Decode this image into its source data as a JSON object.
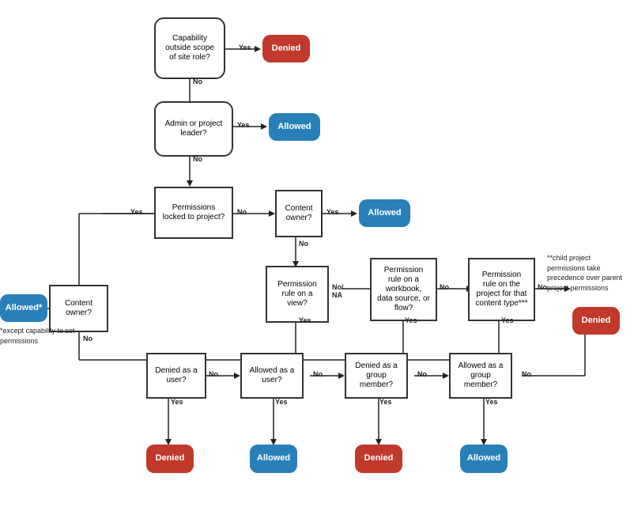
{
  "nodes": {
    "capability": {
      "label": "Capability outside scope of site role?"
    },
    "denied_top": {
      "label": "Denied"
    },
    "admin": {
      "label": "Admin or project leader?"
    },
    "allowed_1": {
      "label": "Allowed"
    },
    "perm_locked": {
      "label": "Permissions locked to project?"
    },
    "content_owner_mid": {
      "label": "Content owner?"
    },
    "allowed_2": {
      "label": "Allowed"
    },
    "content_owner_left": {
      "label": "Content owner?"
    },
    "allowed_star": {
      "label": "Allowed*"
    },
    "perm_view": {
      "label": "Permission rule on a view?"
    },
    "perm_workbook": {
      "label": "Permission rule on a workbook, data source, or flow?"
    },
    "perm_project": {
      "label": "Permission rule on the project for that content type***"
    },
    "denied_right": {
      "label": "Denied"
    },
    "denied_user": {
      "label": "Denied as a user?"
    },
    "allowed_user": {
      "label": "Allowed as a user?"
    },
    "denied_group": {
      "label": "Denied as a group member?"
    },
    "allowed_group": {
      "label": "Allowed as a group member?"
    },
    "denied_b1": {
      "label": "Denied"
    },
    "allowed_b2": {
      "label": "Allowed"
    },
    "denied_b3": {
      "label": "Denied"
    },
    "allowed_b4": {
      "label": "Allowed"
    }
  },
  "notes": {
    "star_note": "*except capability to set permissions",
    "child_note": "**child project permissions take precedence over parent project permissions"
  },
  "labels": {
    "yes": "Yes",
    "no": "No",
    "no_na": "No/ NA"
  }
}
